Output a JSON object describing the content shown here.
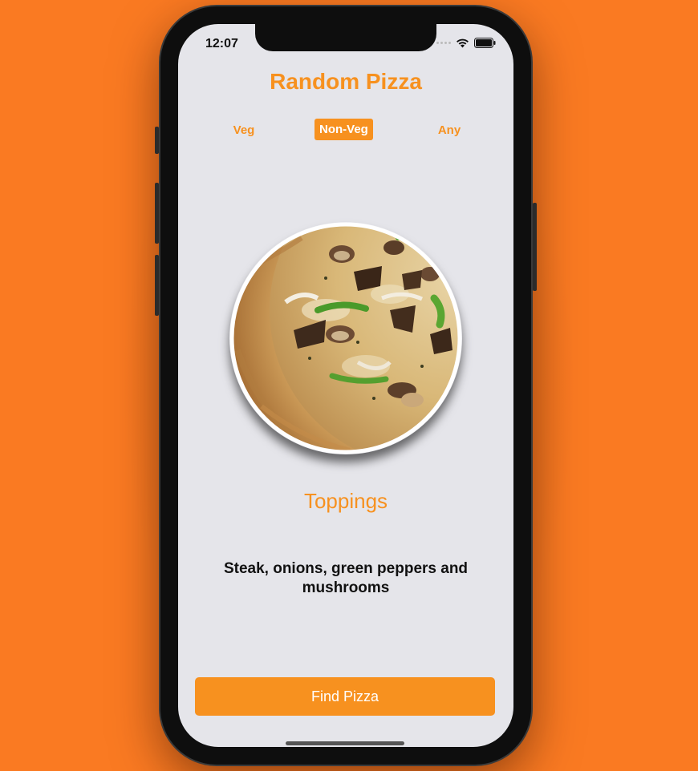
{
  "status_bar": {
    "time": "12:07"
  },
  "app": {
    "title": "Random Pizza"
  },
  "segments": [
    {
      "label": "Veg",
      "selected": false
    },
    {
      "label": "Non-Veg",
      "selected": true
    },
    {
      "label": "Any",
      "selected": false
    }
  ],
  "pizza": {
    "image_icon": "pizza-image"
  },
  "toppings": {
    "heading": "Toppings",
    "description": "Steak, onions, green peppers and mushrooms"
  },
  "actions": {
    "find_label": "Find Pizza"
  },
  "colors": {
    "accent": "#f7911f",
    "background": "#fa7a22",
    "screen": "#e5e5ea"
  }
}
